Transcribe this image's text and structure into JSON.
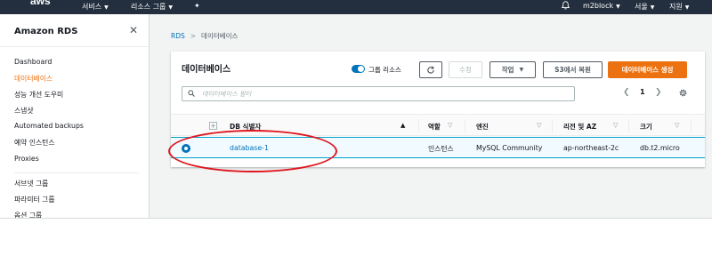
{
  "topnav": {
    "logo": "aws",
    "services": "서비스",
    "resource_groups": "리소스 그룹",
    "account": "m2block",
    "region": "서울",
    "support": "지원",
    "icons": [
      "pin-icon",
      "bell-icon",
      "chevron-down-icon"
    ]
  },
  "sidebar": {
    "title": "Amazon RDS",
    "items": [
      {
        "label": "Dashboard",
        "active": false
      },
      {
        "label": "데이터베이스",
        "active": true
      },
      {
        "label": "성능 개선 도우미",
        "active": false
      },
      {
        "label": "스냅샷",
        "active": false
      },
      {
        "label": "Automated backups",
        "active": false
      },
      {
        "label": "예약 인스턴스",
        "active": false
      },
      {
        "label": "Proxies",
        "active": false
      },
      {
        "label": "서브넷 그룹",
        "active": false
      },
      {
        "label": "파라미터 그룹",
        "active": false
      },
      {
        "label": "옵션 그룹",
        "active": false
      }
    ]
  },
  "breadcrumb": {
    "root": "RDS",
    "current": "데이터베이스"
  },
  "panel": {
    "title": "데이터베이스",
    "group_resources_label": "그룹 리소스",
    "group_resources_on": true,
    "buttons": {
      "modify": "수정",
      "actions": "작업",
      "restore_s3": "S3에서 복원",
      "create": "데이터베이스 생성"
    },
    "search_placeholder": "데이터베이스 필터",
    "page_number": "1"
  },
  "table": {
    "columns": [
      "DB 식별자",
      "역할",
      "엔진",
      "리전 및 AZ",
      "크기"
    ],
    "rows": [
      {
        "selected": true,
        "db_identifier": "database-1",
        "role": "인스턴스",
        "engine": "MySQL Community",
        "region_az": "ap-northeast-2c",
        "size": "db.t2.micro"
      }
    ]
  },
  "colors": {
    "nav_bg": "#232f3e",
    "accent_orange": "#ec7211",
    "link_blue": "#0073bb",
    "selected_row_bg": "#f1faff",
    "annotation_red": "#e0161e"
  }
}
